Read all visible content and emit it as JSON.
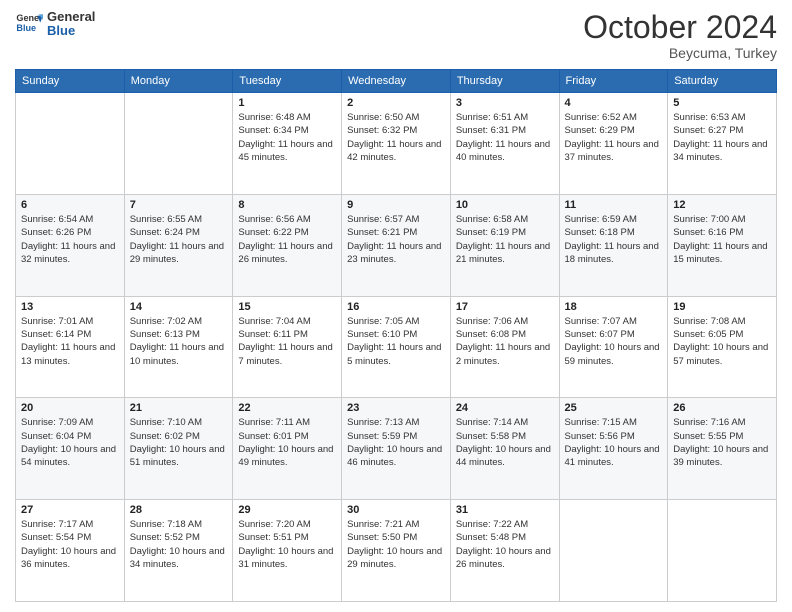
{
  "header": {
    "logo_text_general": "General",
    "logo_text_blue": "Blue",
    "month": "October 2024",
    "location": "Beycuma, Turkey"
  },
  "days_of_week": [
    "Sunday",
    "Monday",
    "Tuesday",
    "Wednesday",
    "Thursday",
    "Friday",
    "Saturday"
  ],
  "weeks": [
    [
      {
        "day": "",
        "info": ""
      },
      {
        "day": "",
        "info": ""
      },
      {
        "day": "1",
        "info": "Sunrise: 6:48 AM\nSunset: 6:34 PM\nDaylight: 11 hours and 45 minutes."
      },
      {
        "day": "2",
        "info": "Sunrise: 6:50 AM\nSunset: 6:32 PM\nDaylight: 11 hours and 42 minutes."
      },
      {
        "day": "3",
        "info": "Sunrise: 6:51 AM\nSunset: 6:31 PM\nDaylight: 11 hours and 40 minutes."
      },
      {
        "day": "4",
        "info": "Sunrise: 6:52 AM\nSunset: 6:29 PM\nDaylight: 11 hours and 37 minutes."
      },
      {
        "day": "5",
        "info": "Sunrise: 6:53 AM\nSunset: 6:27 PM\nDaylight: 11 hours and 34 minutes."
      }
    ],
    [
      {
        "day": "6",
        "info": "Sunrise: 6:54 AM\nSunset: 6:26 PM\nDaylight: 11 hours and 32 minutes."
      },
      {
        "day": "7",
        "info": "Sunrise: 6:55 AM\nSunset: 6:24 PM\nDaylight: 11 hours and 29 minutes."
      },
      {
        "day": "8",
        "info": "Sunrise: 6:56 AM\nSunset: 6:22 PM\nDaylight: 11 hours and 26 minutes."
      },
      {
        "day": "9",
        "info": "Sunrise: 6:57 AM\nSunset: 6:21 PM\nDaylight: 11 hours and 23 minutes."
      },
      {
        "day": "10",
        "info": "Sunrise: 6:58 AM\nSunset: 6:19 PM\nDaylight: 11 hours and 21 minutes."
      },
      {
        "day": "11",
        "info": "Sunrise: 6:59 AM\nSunset: 6:18 PM\nDaylight: 11 hours and 18 minutes."
      },
      {
        "day": "12",
        "info": "Sunrise: 7:00 AM\nSunset: 6:16 PM\nDaylight: 11 hours and 15 minutes."
      }
    ],
    [
      {
        "day": "13",
        "info": "Sunrise: 7:01 AM\nSunset: 6:14 PM\nDaylight: 11 hours and 13 minutes."
      },
      {
        "day": "14",
        "info": "Sunrise: 7:02 AM\nSunset: 6:13 PM\nDaylight: 11 hours and 10 minutes."
      },
      {
        "day": "15",
        "info": "Sunrise: 7:04 AM\nSunset: 6:11 PM\nDaylight: 11 hours and 7 minutes."
      },
      {
        "day": "16",
        "info": "Sunrise: 7:05 AM\nSunset: 6:10 PM\nDaylight: 11 hours and 5 minutes."
      },
      {
        "day": "17",
        "info": "Sunrise: 7:06 AM\nSunset: 6:08 PM\nDaylight: 11 hours and 2 minutes."
      },
      {
        "day": "18",
        "info": "Sunrise: 7:07 AM\nSunset: 6:07 PM\nDaylight: 10 hours and 59 minutes."
      },
      {
        "day": "19",
        "info": "Sunrise: 7:08 AM\nSunset: 6:05 PM\nDaylight: 10 hours and 57 minutes."
      }
    ],
    [
      {
        "day": "20",
        "info": "Sunrise: 7:09 AM\nSunset: 6:04 PM\nDaylight: 10 hours and 54 minutes."
      },
      {
        "day": "21",
        "info": "Sunrise: 7:10 AM\nSunset: 6:02 PM\nDaylight: 10 hours and 51 minutes."
      },
      {
        "day": "22",
        "info": "Sunrise: 7:11 AM\nSunset: 6:01 PM\nDaylight: 10 hours and 49 minutes."
      },
      {
        "day": "23",
        "info": "Sunrise: 7:13 AM\nSunset: 5:59 PM\nDaylight: 10 hours and 46 minutes."
      },
      {
        "day": "24",
        "info": "Sunrise: 7:14 AM\nSunset: 5:58 PM\nDaylight: 10 hours and 44 minutes."
      },
      {
        "day": "25",
        "info": "Sunrise: 7:15 AM\nSunset: 5:56 PM\nDaylight: 10 hours and 41 minutes."
      },
      {
        "day": "26",
        "info": "Sunrise: 7:16 AM\nSunset: 5:55 PM\nDaylight: 10 hours and 39 minutes."
      }
    ],
    [
      {
        "day": "27",
        "info": "Sunrise: 7:17 AM\nSunset: 5:54 PM\nDaylight: 10 hours and 36 minutes."
      },
      {
        "day": "28",
        "info": "Sunrise: 7:18 AM\nSunset: 5:52 PM\nDaylight: 10 hours and 34 minutes."
      },
      {
        "day": "29",
        "info": "Sunrise: 7:20 AM\nSunset: 5:51 PM\nDaylight: 10 hours and 31 minutes."
      },
      {
        "day": "30",
        "info": "Sunrise: 7:21 AM\nSunset: 5:50 PM\nDaylight: 10 hours and 29 minutes."
      },
      {
        "day": "31",
        "info": "Sunrise: 7:22 AM\nSunset: 5:48 PM\nDaylight: 10 hours and 26 minutes."
      },
      {
        "day": "",
        "info": ""
      },
      {
        "day": "",
        "info": ""
      }
    ]
  ]
}
